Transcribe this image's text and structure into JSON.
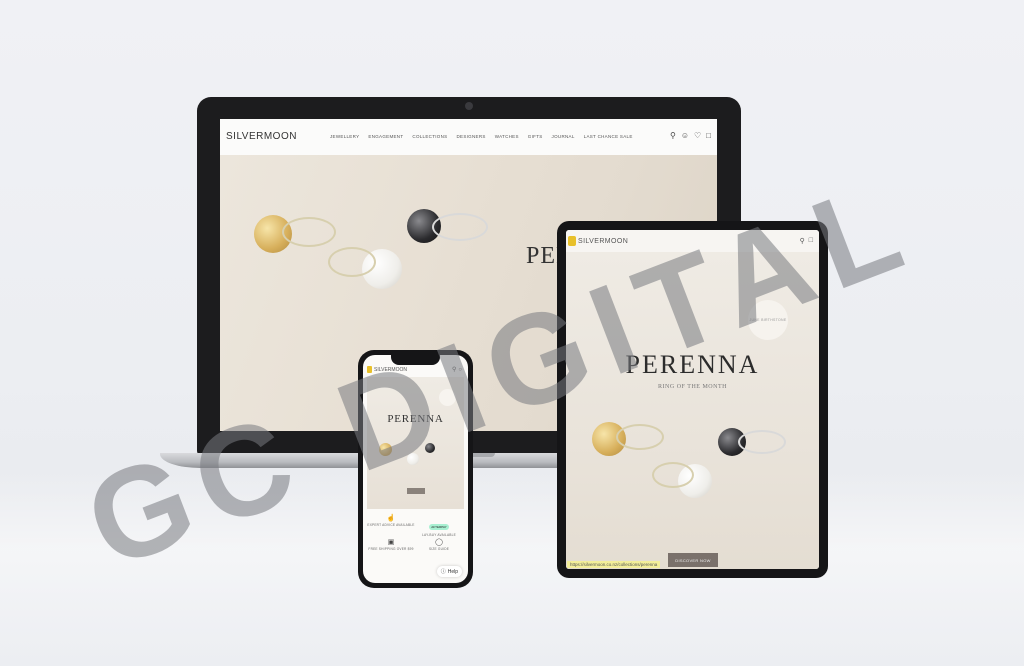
{
  "laptop": {
    "logo": "SILVERMOON",
    "menu": [
      "JEWELLERY",
      "ENGAGEMENT",
      "COLLECTIONS",
      "DESIGNERS",
      "WATCHES",
      "GIFTS",
      "JOURNAL",
      "LAST CHANCE SALE"
    ],
    "icons": [
      "search-icon",
      "account-icon",
      "heart-icon",
      "bag-icon"
    ],
    "hero_title": "PEREN"
  },
  "tablet": {
    "logo": "SILVERMOON",
    "badge": "JUNE BIRTHSTONE",
    "hero_title": "PERENNA",
    "hero_subtitle": "RING OF THE MONTH",
    "cta": "DISCOVER NOW",
    "status_url": "https://silvermoon.co.nz/collections/perenna"
  },
  "phone": {
    "logo": "SILVERMOON",
    "hero_title": "PERENNA",
    "usps": [
      {
        "icon": "hand-icon",
        "text": "EXPERT ADVICE AVAILABLE"
      },
      {
        "icon": "afterpay-badge",
        "text": "AFTERPAY",
        "sub": "LAY-BUY AVAILABLE"
      },
      {
        "icon": "gift-icon",
        "text": "FREE SHIPPING OVER $99"
      },
      {
        "icon": "ring-icon",
        "text": "SIZE GUIDE"
      }
    ],
    "help_label": "Help"
  },
  "watermark": "GC DIGITAL",
  "colors": {
    "background": "#eceef2",
    "device_frame": "#1c1c1e",
    "hero_beige": "#e7dfd3",
    "logo_yellow": "#e8c02a",
    "afterpay_mint": "#a8f0d2",
    "cta_brown": "#7a716b"
  }
}
